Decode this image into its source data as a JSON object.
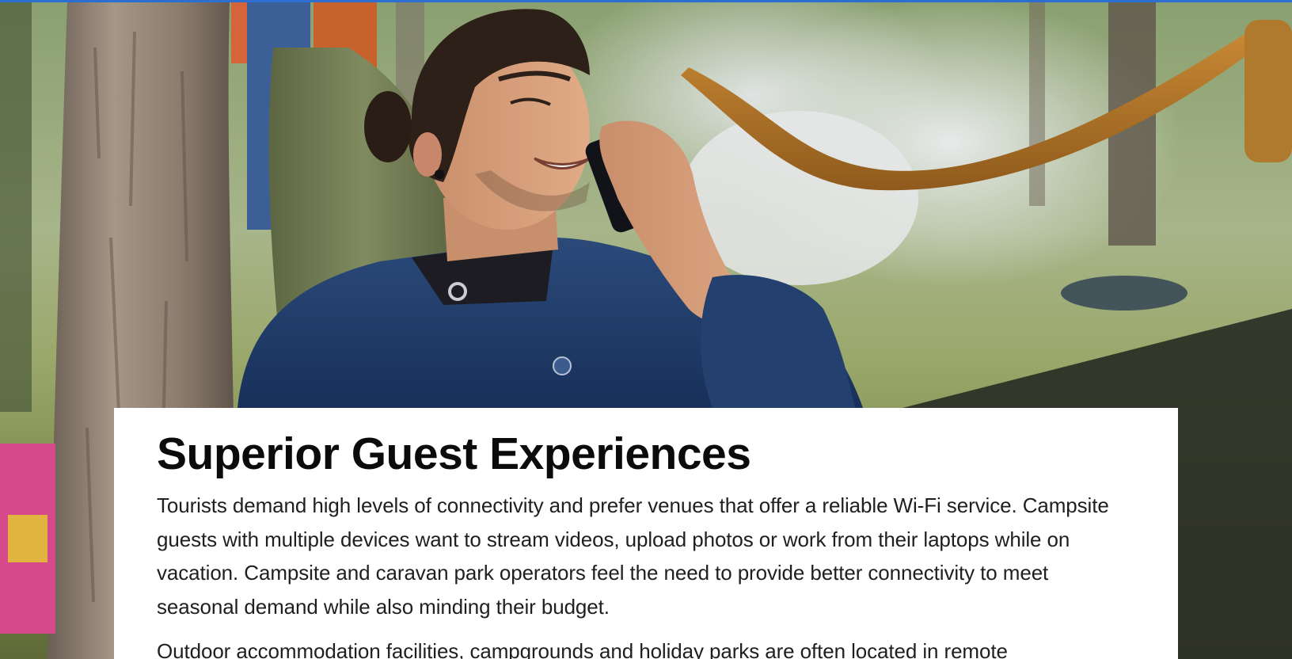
{
  "section": {
    "headline": "Superior Guest Experiences",
    "paragraphs": [
      "Tourists demand high levels of connectivity and prefer venues that offer a reliable Wi-Fi service. Campsite guests with multiple devices want to stream videos, upload photos or work from their laptops while on vacation. Campsite and caravan park operators feel the need to provide better connectivity to meet seasonal demand while also minding their budget.",
      "Outdoor accommodation facilities, campgrounds and holiday parks are often located in remote"
    ]
  },
  "hero_image": {
    "subject": "man-on-phone-in-hammock-campsite",
    "colors": {
      "accent_bar": "#2d6fd0",
      "hoodie": "#1f3b66",
      "hammock_green": "#6f7a52",
      "hammock_orange": "#b97a2a",
      "tree_trunk": "#8a7a6a",
      "grass": "#9aa76a"
    }
  }
}
